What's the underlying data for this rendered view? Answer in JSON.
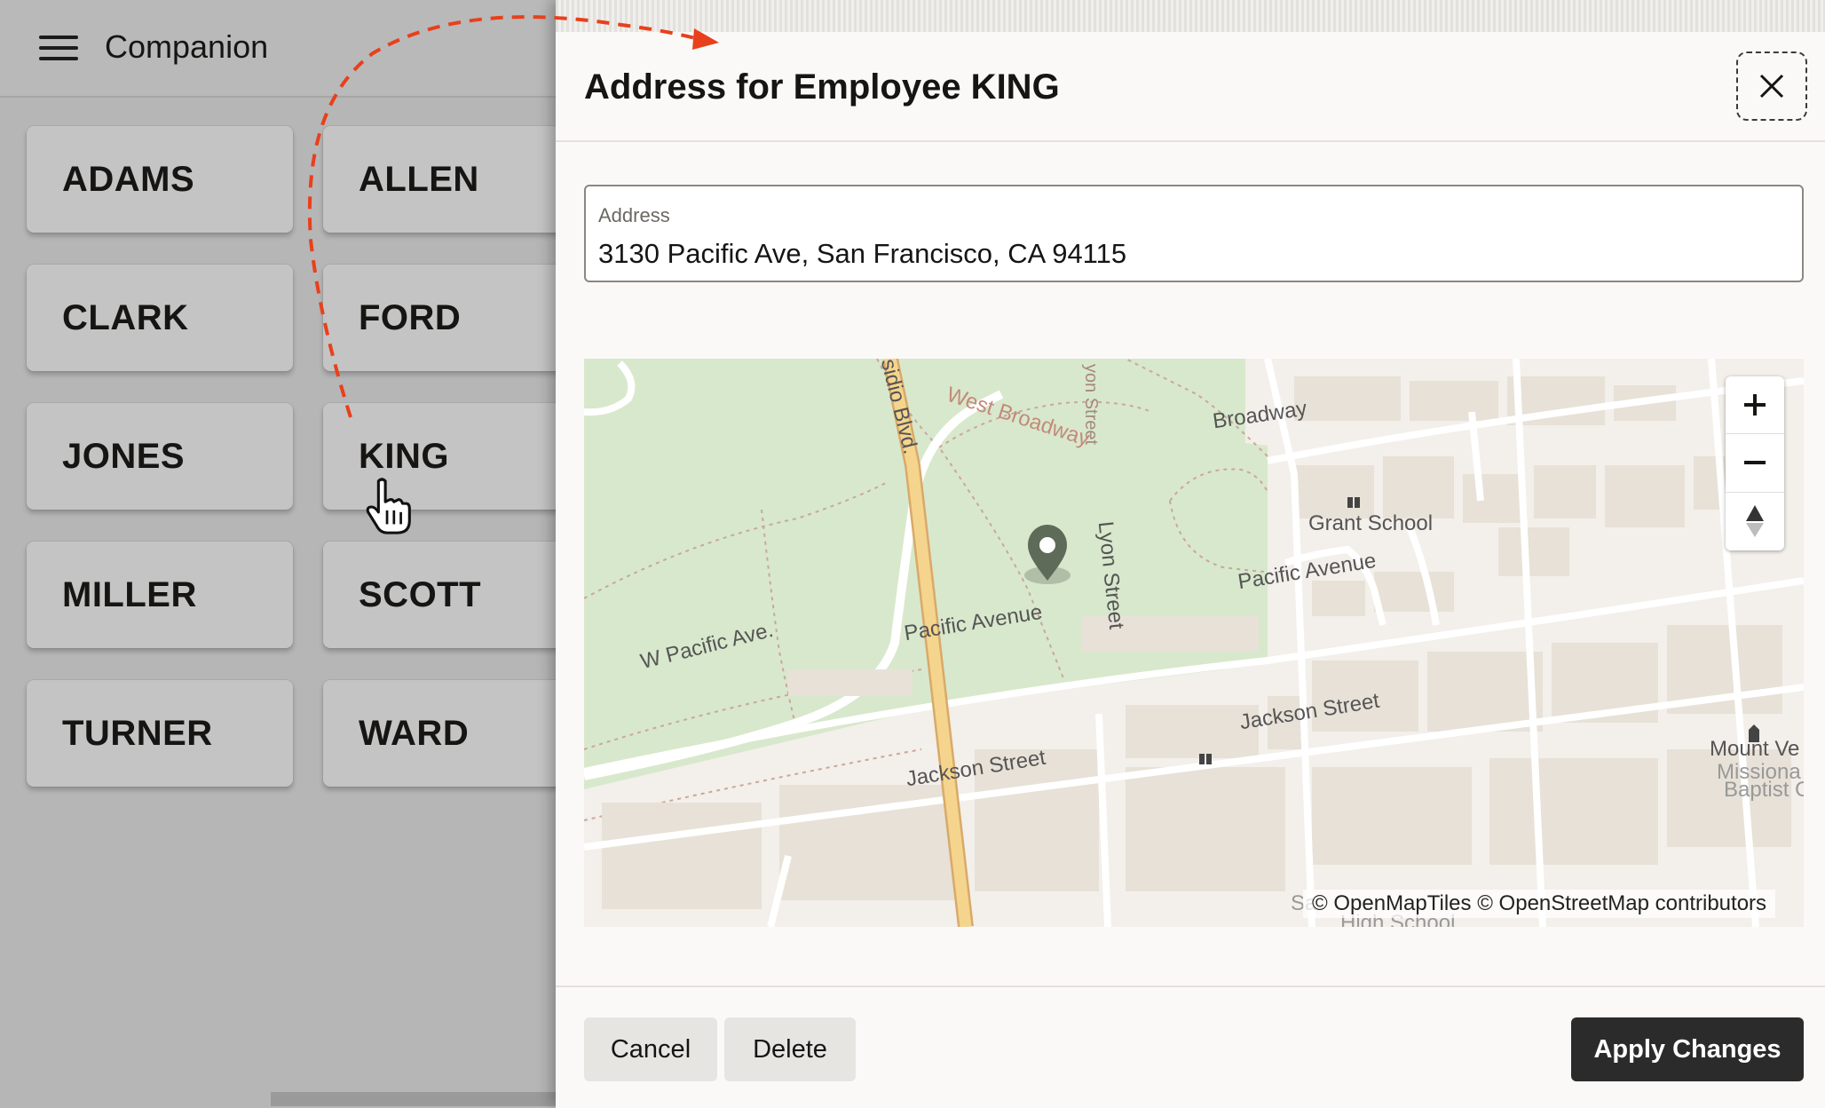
{
  "app": {
    "title": "Companion",
    "employees": [
      "ADAMS",
      "ALLEN",
      "CLARK",
      "FORD",
      "JONES",
      "KING",
      "MILLER",
      "SCOTT",
      "TURNER",
      "WARD"
    ]
  },
  "drawer": {
    "title": "Address for Employee KING",
    "address_label": "Address",
    "address_value": "3130 Pacific Ave, San Francisco, CA 94115",
    "map": {
      "attribution": "© OpenMapTiles  © OpenStreetMap contributors",
      "labels": {
        "broadway": "Broadway",
        "west_broadway": "West Broadway",
        "presidio": "sidio Blvd.",
        "lyon": "Lyon Street",
        "lyon_top": "yon Street",
        "grant": "Grant School",
        "pacific_ave_r": "Pacific Avenue",
        "pacific_ave_m": "Pacific Avenue",
        "w_pacific": "W Pacific Ave.",
        "jackson_r": "Jackson Street",
        "jackson_l": "Jackson Street",
        "mount_ve": "Mount Ve",
        "missiona": "Missiona",
        "baptist": "Baptist Ch",
        "hs_sa": "Sa",
        "hs_high": "High School"
      },
      "zoom_in_icon": "plus-icon",
      "zoom_out_icon": "minus-icon",
      "compass_icon": "compass-icon"
    },
    "footer": {
      "cancel": "Cancel",
      "delete": "Delete",
      "apply": "Apply Changes"
    }
  },
  "colors": {
    "accent_dark": "#2b2b2b",
    "marker": "#5e6b58",
    "park": "#d8e8cc",
    "main_road": "#f5d58d",
    "path_arrow": "#e8401c"
  }
}
